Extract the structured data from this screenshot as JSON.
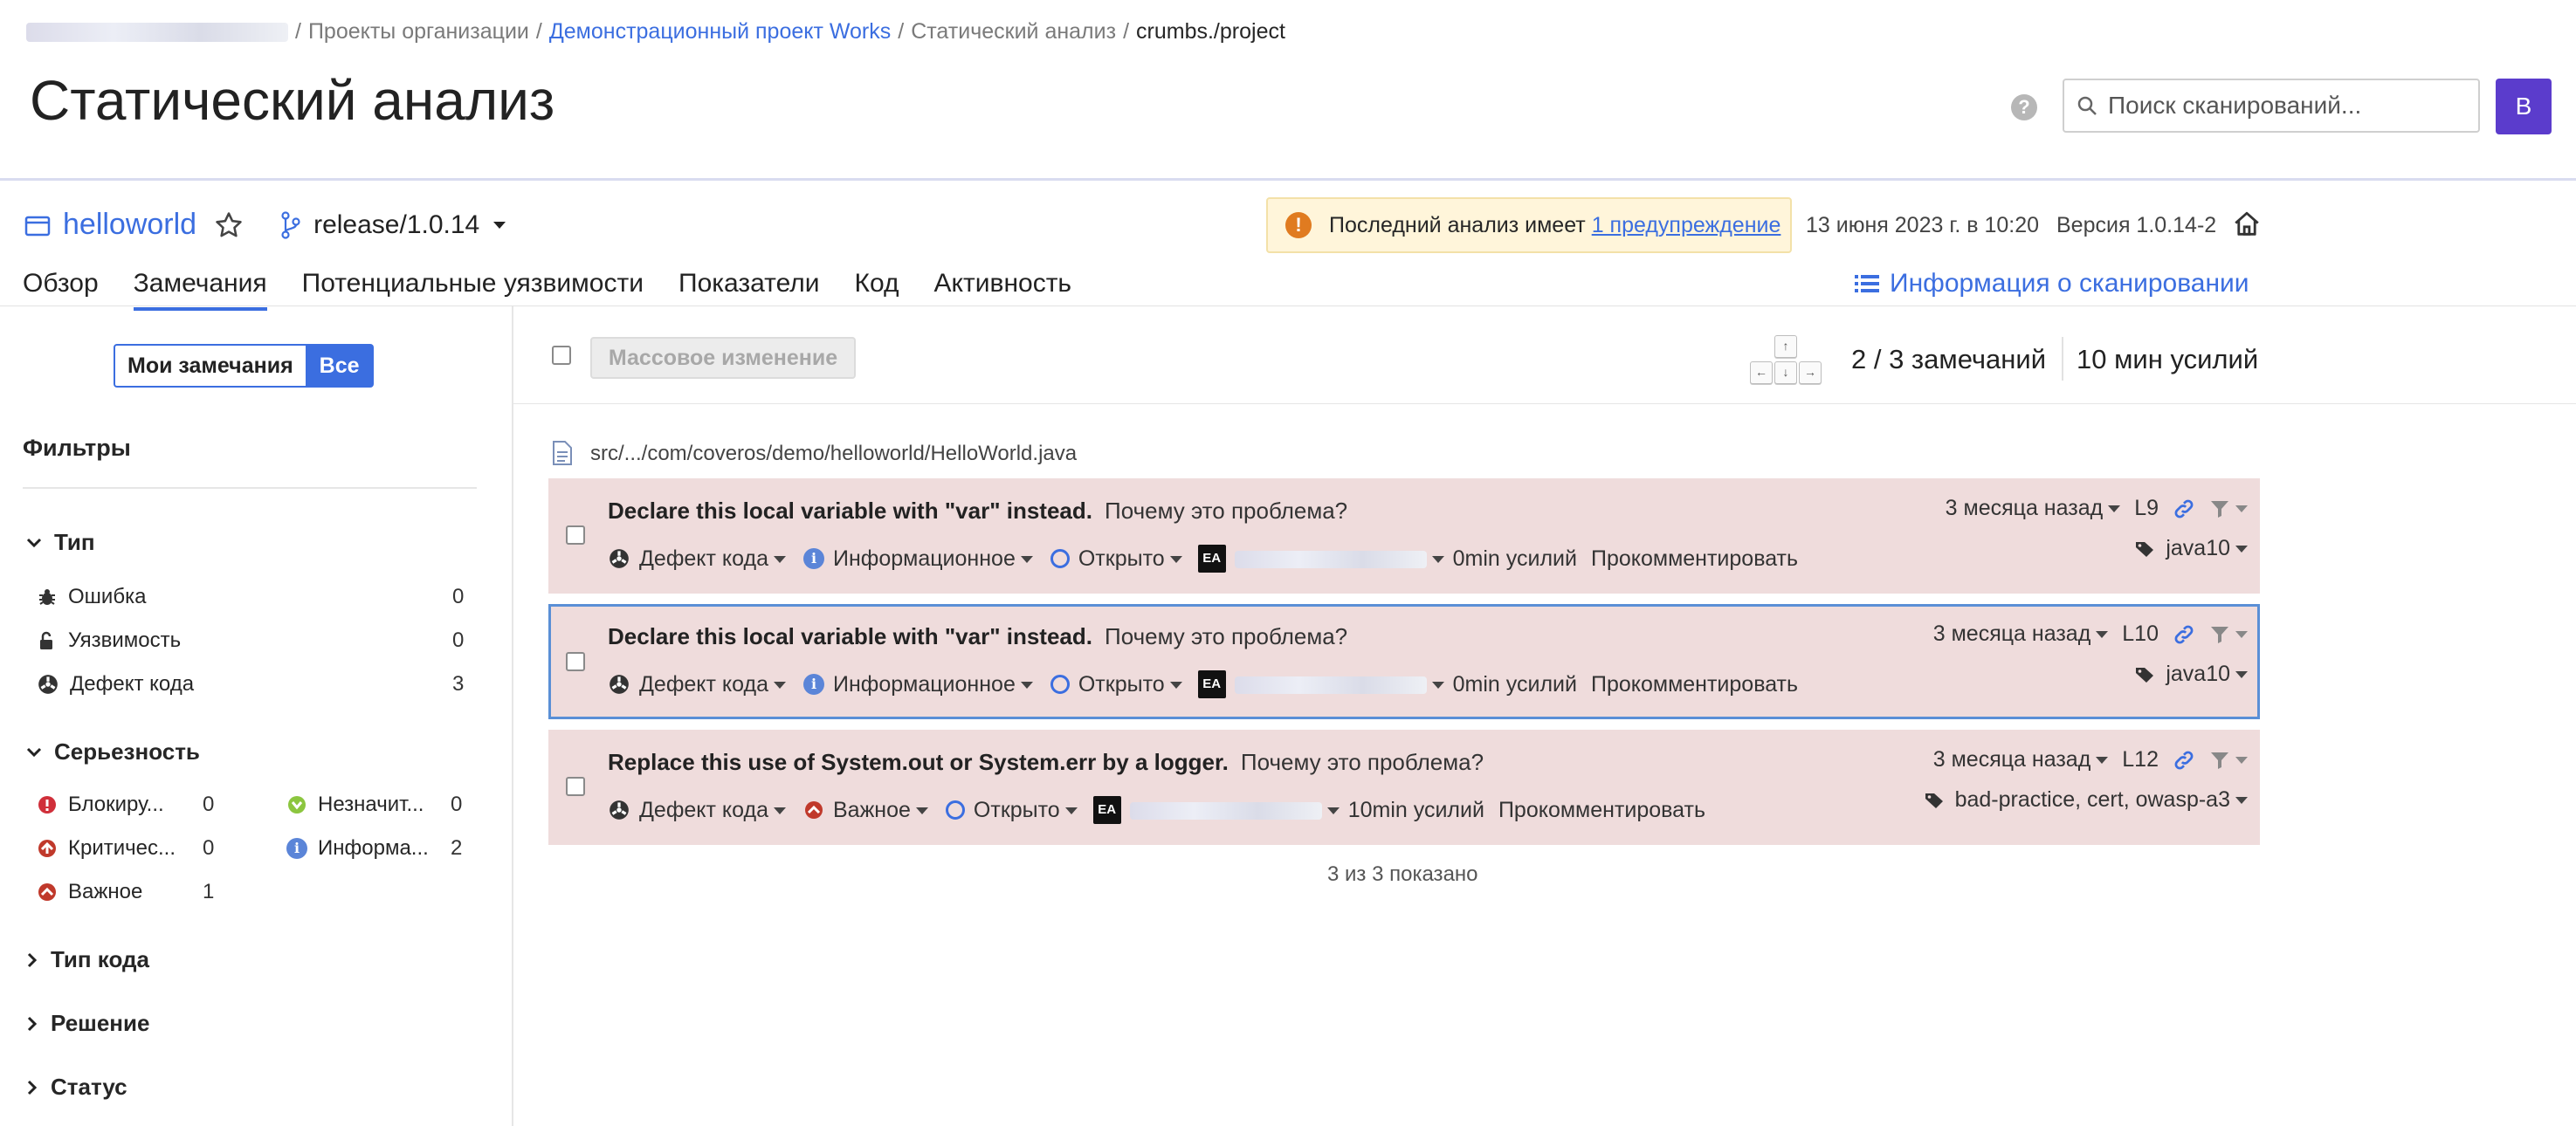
{
  "breadcrumb": {
    "items": [
      "Проекты организации",
      "Демонстрационный проект Works",
      "Статический анализ",
      "crumbs./project"
    ],
    "sep": "/"
  },
  "header": {
    "title": "Статический анализ",
    "search_placeholder": "Поиск сканирований...",
    "avatar_letter": "B"
  },
  "project": {
    "name": "helloworld",
    "branch": "release/1.0.14",
    "warning_text": "Последний анализ имеет",
    "warning_link": "1 предупреждение",
    "date": "13 июня 2023 г. в 10:20",
    "version": "Версия 1.0.14-2"
  },
  "tabs": [
    {
      "label": "Обзор"
    },
    {
      "label": "Замечания"
    },
    {
      "label": "Потенциальные уязвимости"
    },
    {
      "label": "Показатели"
    },
    {
      "label": "Код"
    },
    {
      "label": "Активность"
    }
  ],
  "scan_info_label": "Информация о сканировании",
  "sidebar": {
    "toggle_mine": "Мои замечания",
    "toggle_all": "Все",
    "filters_title": "Фильтры",
    "type_title": "Тип",
    "types": [
      {
        "label": "Ошибка",
        "count": "0"
      },
      {
        "label": "Уязвимость",
        "count": "0"
      },
      {
        "label": "Дефект кода",
        "count": "3"
      }
    ],
    "severity_title": "Серьезность",
    "severities": [
      {
        "label": "Блокиру...",
        "count": "0"
      },
      {
        "label": "Незначит...",
        "count": "0"
      },
      {
        "label": "Критичес...",
        "count": "0"
      },
      {
        "label": "Информа...",
        "count": "2"
      },
      {
        "label": "Важное",
        "count": "1"
      }
    ],
    "sections": [
      "Тип кода",
      "Решение",
      "Статус"
    ]
  },
  "toolbar": {
    "bulk_change": "Массовое изменение",
    "issue_count": "2 / 3 замечаний",
    "effort_total": "10 мин усилий"
  },
  "file_path": "src/.../com/coveros/demo/helloworld/HelloWorld.java",
  "issues": [
    {
      "message": "Declare this local variable with \"var\" instead.",
      "why": "Почему это проблема?",
      "type": "Дефект кода",
      "severity": "Информационное",
      "status": "Открыто",
      "assignee_initials": "EA",
      "effort": "0min усилий",
      "comment": "Прокомментировать",
      "age": "3 месяца назад",
      "line": "L9",
      "tags": "java10"
    },
    {
      "message": "Declare this local variable with \"var\" instead.",
      "why": "Почему это проблема?",
      "type": "Дефект кода",
      "severity": "Информационное",
      "status": "Открыто",
      "assignee_initials": "EA",
      "effort": "0min усилий",
      "comment": "Прокомментировать",
      "age": "3 месяца назад",
      "line": "L10",
      "tags": "java10"
    },
    {
      "message": "Replace this use of System.out or System.err by a logger.",
      "why": "Почему это проблема?",
      "type": "Дефект кода",
      "severity": "Важное",
      "status": "Открыто",
      "assignee_initials": "EA",
      "effort": "10min усилий",
      "comment": "Прокомментировать",
      "age": "3 месяца назад",
      "line": "L12",
      "tags": "bad-practice, cert, owasp-a3"
    }
  ],
  "shown_count": "3 из 3 показано",
  "colors": {
    "accent": "#3b6ee0",
    "issue_bg": "#efdcdc",
    "avatar_bg": "#5b3ccc",
    "blocker": "#d02f3a",
    "minor": "#8cc63f",
    "major": "#c0392b"
  }
}
